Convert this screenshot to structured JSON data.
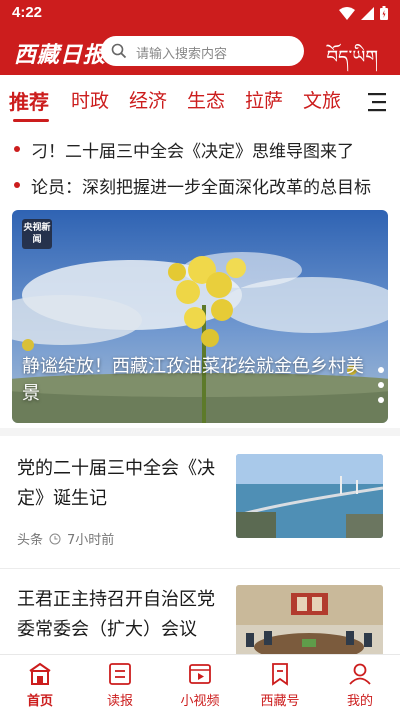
{
  "status": {
    "time": "4:22"
  },
  "header": {
    "logo": "西藏日报",
    "search_placeholder": "请输入搜索内容",
    "tibetan_title": "བོད་ཡིག"
  },
  "tabs": [
    {
      "label": "推荐",
      "active": true
    },
    {
      "label": "时政"
    },
    {
      "label": "经济"
    },
    {
      "label": "生态"
    },
    {
      "label": "拉萨"
    },
    {
      "label": "文旅"
    }
  ],
  "ticker": [
    "刁！二十届三中全会《决定》思维导图来了",
    "论员：深刻把握进一步全面深化改革的总目标"
  ],
  "hero": {
    "badge": "央视新闻",
    "caption": "静谧绽放！西藏江孜油菜花绘就金色乡村美景",
    "slide_count": 3
  },
  "news": [
    {
      "title": "党的二十届三中全会《决定》诞生记",
      "source": "头条",
      "time": "7小时前"
    },
    {
      "title": "王君正主持召开自治区党委常委会（扩大）会议"
    }
  ],
  "bottom_nav": [
    {
      "label": "首页",
      "icon": "home-icon",
      "active": true
    },
    {
      "label": "读报",
      "icon": "newspaper-icon"
    },
    {
      "label": "小视频",
      "icon": "video-icon"
    },
    {
      "label": "西藏号",
      "icon": "bookmark-icon"
    },
    {
      "label": "我的",
      "icon": "user-icon"
    }
  ],
  "colors": {
    "brand": "#cc1d1d",
    "text": "#1a1a1a",
    "meta": "#777777"
  }
}
